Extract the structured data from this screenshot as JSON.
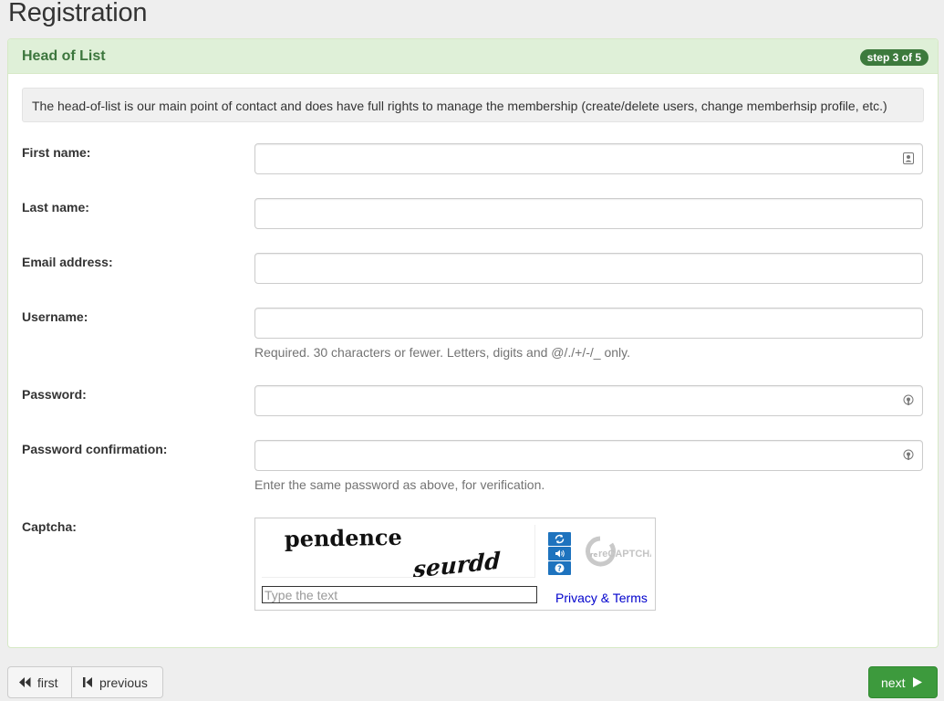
{
  "page": {
    "title": "Registration"
  },
  "panel": {
    "title": "Head of List",
    "step": "step 3 of 5",
    "info": "The head-of-list is our main point of contact and does have full rights to manage the membership (create/delete users, change memberhsip profile, etc.)"
  },
  "form": {
    "first_name": {
      "label": "First name:",
      "value": ""
    },
    "last_name": {
      "label": "Last name:",
      "value": ""
    },
    "email": {
      "label": "Email address:",
      "value": ""
    },
    "username": {
      "label": "Username:",
      "value": "",
      "help": "Required. 30 characters or fewer. Letters, digits and @/./+/-/_ only."
    },
    "password": {
      "label": "Password:",
      "value": ""
    },
    "password_confirm": {
      "label": "Password confirmation:",
      "value": "",
      "help": "Enter the same password as above, for verification."
    },
    "captcha": {
      "label": "Captcha:",
      "word1": "pendence",
      "word2": "seurdd",
      "placeholder": "Type the text",
      "logo_text": "reCAPTCHA™",
      "privacy": "Privacy & Terms"
    }
  },
  "nav": {
    "first": "first",
    "previous": "previous",
    "next": "next"
  },
  "colors": {
    "panel_heading_bg": "#dff0d8",
    "panel_title": "#3c763d",
    "step_badge": "#3d7a3d",
    "next_button": "#3d9a3d"
  }
}
